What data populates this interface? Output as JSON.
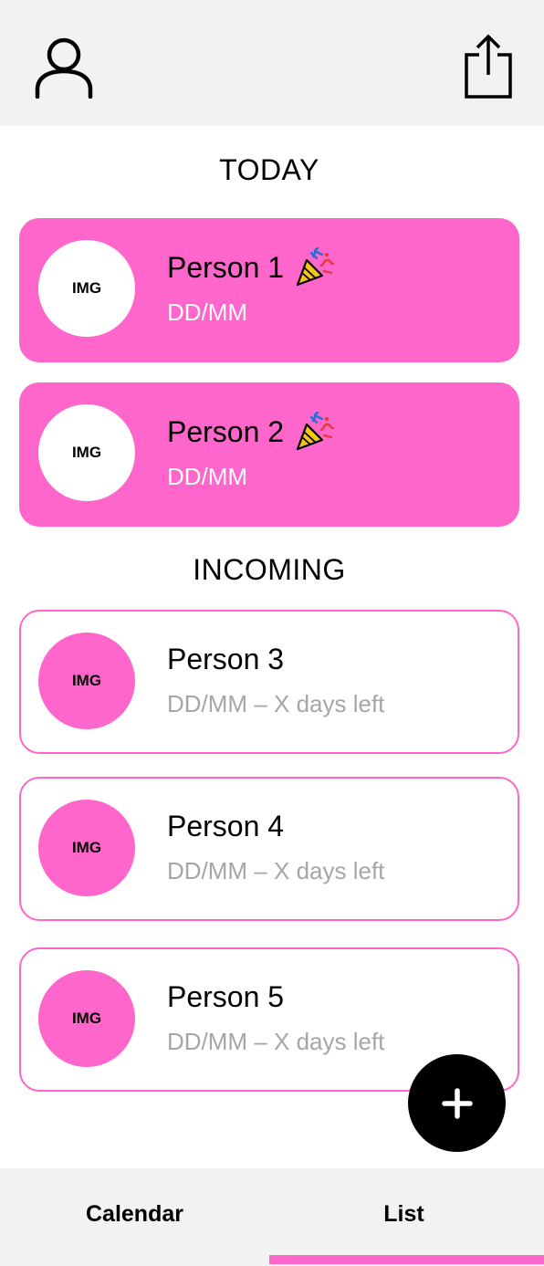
{
  "header": {
    "profile_icon": "user-icon",
    "share_icon": "share-icon"
  },
  "sections": {
    "today_title": "TODAY",
    "incoming_title": "INCOMING"
  },
  "today": [
    {
      "avatar": "IMG",
      "name": "Person 1",
      "date": "DD/MM",
      "icon": "party-popper-icon"
    },
    {
      "avatar": "IMG",
      "name": "Person 2",
      "date": "DD/MM",
      "icon": "party-popper-icon"
    }
  ],
  "incoming": [
    {
      "avatar": "IMG",
      "name": "Person 3",
      "date": "DD/MM – X days left"
    },
    {
      "avatar": "IMG",
      "name": "Person 4",
      "date": "DD/MM – X days left"
    },
    {
      "avatar": "IMG",
      "name": "Person 5",
      "date": "DD/MM – X days left"
    }
  ],
  "fab": {
    "icon": "plus-icon"
  },
  "tabs": {
    "calendar": "Calendar",
    "list": "List",
    "active": "List"
  },
  "colors": {
    "accent": "#ff66cc",
    "bar_background": "#f2f2f2",
    "muted_text": "#a6a6a6"
  }
}
